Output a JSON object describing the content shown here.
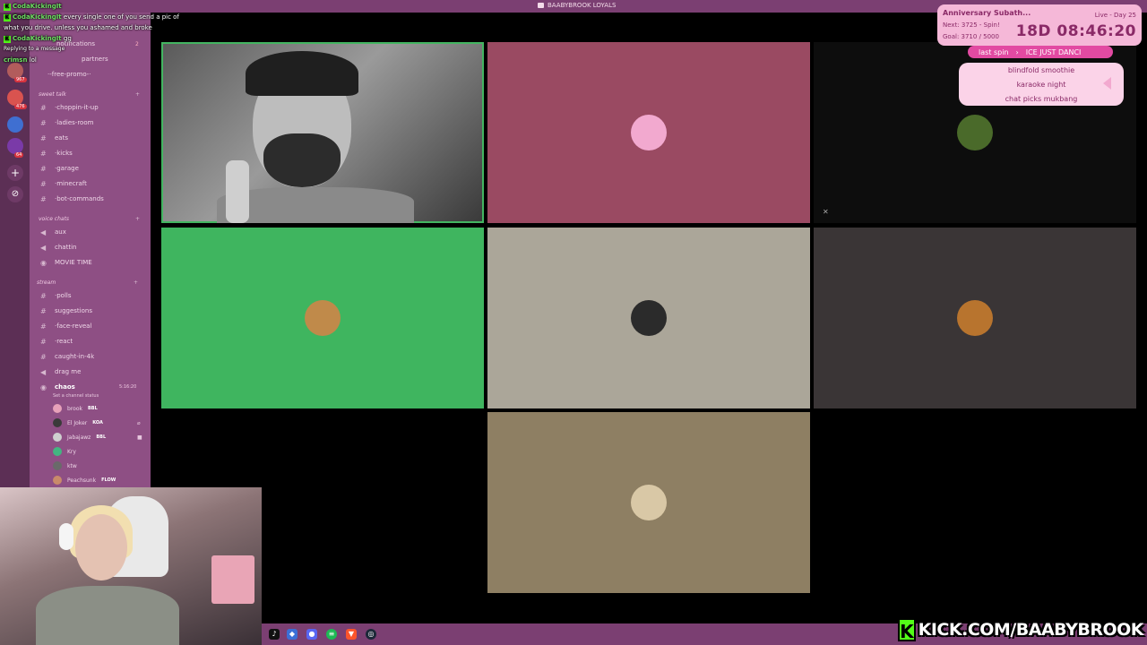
{
  "window": {
    "title": "BAABYBROOK LOYALS"
  },
  "chat": {
    "messages": [
      {
        "user": "CodaKickingIt",
        "text": ""
      },
      {
        "user": "CodaKickingIt",
        "text": "every single one of you send a pic of what you drive. unless you ashamed and broke"
      },
      {
        "user": "CodaKickingIt",
        "text": "gg"
      },
      {
        "user": "",
        "text": "Replying to a message"
      },
      {
        "user": "crimsn",
        "text": "lol"
      }
    ]
  },
  "sidebar": {
    "top_items": [
      {
        "label": "notifications",
        "badge": "2"
      },
      {
        "label": "partners"
      },
      {
        "label": "·-free-promo-·"
      }
    ],
    "categories": {
      "sweet_talk": "sweet talk",
      "voice_chats": "voice chats",
      "stream": "stream"
    },
    "channels_sweet_talk": [
      "·choppin-it-up",
      "·ladies-room",
      "eats",
      "·kicks",
      "·garage",
      "·minecraft",
      "·bot-commands"
    ],
    "channels_voice": [
      "aux",
      "chattin",
      "MOVIE TIME"
    ],
    "channels_stream": [
      "·polls",
      "suggestions",
      "·face-reveal",
      "·react",
      "caught-in-4k",
      "drag me"
    ],
    "voice_channel": {
      "name": "chaos",
      "status": "Set a channel status",
      "time": "5:16:20"
    },
    "voice_users": [
      {
        "name": "brook",
        "tag": "BBL",
        "color": "#e7a1b9"
      },
      {
        "name": "El Joker",
        "tag": "KOA",
        "color": "#3a3a3a"
      },
      {
        "name": "Jabajawz",
        "tag": "BBL",
        "color": "#cfcfcf"
      },
      {
        "name": "Kry",
        "tag": "",
        "color": "#43b581"
      },
      {
        "name": "ktw",
        "tag": "",
        "color": "#6a6a6a"
      },
      {
        "name": "Peachsunk",
        "tag": "FLOW",
        "color": "#c98a6a"
      }
    ],
    "server_badges": [
      "967",
      "476",
      "64"
    ]
  },
  "tiles": [
    {
      "name": "main-webcam",
      "bg": "#5a5a5a"
    },
    {
      "name": "participant-pink",
      "bg": "#9a4a62",
      "avatar": "#f2a9cf"
    },
    {
      "name": "participant-dark",
      "bg": "#0d0d0d",
      "avatar": "#4a6a2a"
    },
    {
      "name": "participant-discord",
      "bg": "#3fb55f",
      "avatar": "#c08a4a"
    },
    {
      "name": "participant-grey",
      "bg": "#aba699",
      "avatar": "#2b2b2b"
    },
    {
      "name": "participant-charcoal",
      "bg": "#3a3536",
      "avatar": "#b8742e"
    },
    {
      "name": "participant-olive",
      "bg": "#8e7f63",
      "avatar": "#d9c8a6"
    }
  ],
  "subathon": {
    "title": "Anniversary Subath...",
    "next": "Next: 3725 - Spin!",
    "goal": "Goal: 3710 / 5000",
    "live": "Live - Day 25",
    "timer": "18D 08:46:20"
  },
  "spin": {
    "label": "last spin",
    "result": "ICE JUST DANCI"
  },
  "wheel_options": [
    "blindfold smoothie",
    "karaoke night",
    "chat picks mukbang"
  ],
  "taskbar_icons": [
    "tiktok-icon",
    "browser-icon",
    "discord-icon",
    "spotify-icon",
    "brave-icon",
    "steam-icon"
  ],
  "kick": {
    "url": "KICK.COM/BAABYBROOK",
    "logo": "K"
  }
}
